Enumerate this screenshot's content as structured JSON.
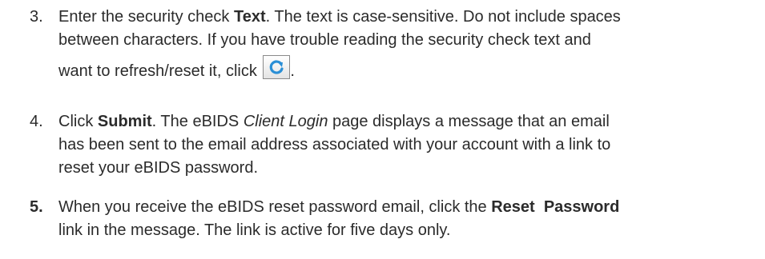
{
  "steps": [
    {
      "number": "3.",
      "line1_a": "Enter the security check ",
      "line1_b": "Text",
      "line1_c": ". The text is case-sensitive. Do not include spaces",
      "line2": "between characters. If you have trouble reading the security check text and",
      "line3_a": "want to refresh/reset it, click ",
      "line3_b": "."
    },
    {
      "number": "4.",
      "line1_a": "Click ",
      "line1_b": "Submit",
      "line1_c": ". The eBIDS ",
      "line1_d": "Client Login",
      "line1_e": " page displays a message that an email",
      "line2": "has been sent to the email address associated with your account with a link to",
      "line3": "reset your eBIDS password."
    },
    {
      "number": "5.",
      "line1_a": "When you receive the eBIDS reset password email, click the ",
      "line1_b": "Reset  Password",
      "line2": "link in the message. The link is active for five days only."
    }
  ],
  "icons": {
    "refresh": "refresh-icon",
    "refresh_color": "#2a8fd6"
  }
}
